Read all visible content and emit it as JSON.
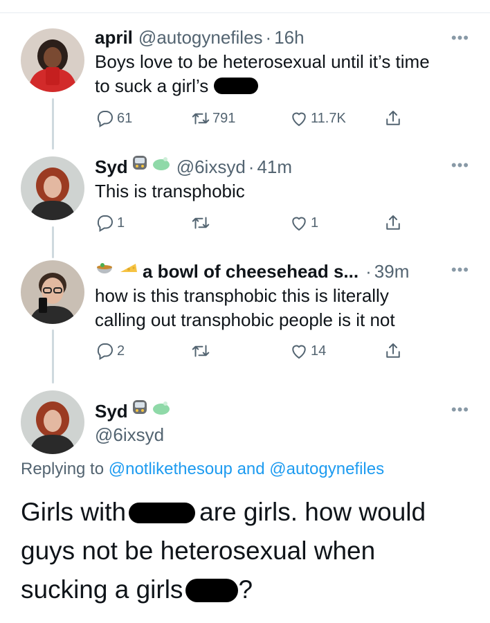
{
  "tweets": [
    {
      "name": "april",
      "handle": "@autogynefiles",
      "sep": "·",
      "time": "16h",
      "text_a": "Boys love to be heterosexual until it’s time",
      "text_b": "to suck a girl’s",
      "replies": "61",
      "retweets": "791",
      "likes": "11.7K"
    },
    {
      "name": "Syd",
      "handle": "@6ixsyd",
      "sep": "·",
      "time": "41m",
      "text": "This is transphobic",
      "replies": "1",
      "retweets": "",
      "likes": "1"
    },
    {
      "name": "a bowl of cheesehead s...",
      "sep": "·",
      "time": "39m",
      "text_a": "how is this transphobic this is literally",
      "text_b": "calling out transphobic people is it not",
      "replies": "2",
      "retweets": "",
      "likes": "14"
    }
  ],
  "focused": {
    "name": "Syd",
    "handle": "@6ixsyd",
    "replying_prefix": "Replying to",
    "replying_user1": "@notlikethesoup",
    "replying_and": "and",
    "replying_user2": "@autogynefiles",
    "text_a": "Girls with",
    "text_b": "are girls. how would",
    "text_c": "guys not be heterosexual when",
    "text_d": "sucking a girls",
    "text_e": "?"
  },
  "more_label": "•••",
  "icons": {
    "reply": "reply-icon",
    "retweet": "retweet-icon",
    "like": "heart-icon",
    "share": "share-icon",
    "more": "more-icon"
  },
  "colors": {
    "link": "#1d9bf0",
    "secondary": "#536471",
    "thread_line": "#cfd9de"
  }
}
